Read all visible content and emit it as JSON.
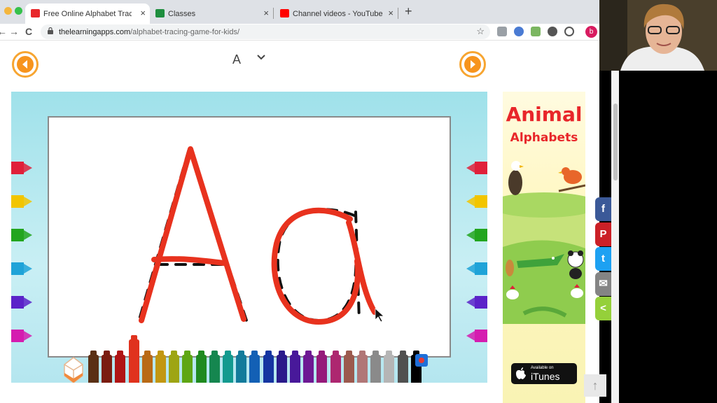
{
  "browser": {
    "tabs": [
      {
        "title": "Free Online Alphabet Tracing G",
        "close": "×",
        "favicon_color": "#e8262a",
        "active": true
      },
      {
        "title": "Classes",
        "close": "×",
        "favicon_color": "#1e8e3e",
        "active": false
      },
      {
        "title": "Channel videos - YouTube Stu",
        "close": "×",
        "favicon_color": "#ff0000",
        "active": false
      }
    ],
    "new_tab": "+",
    "url_domain": "thelearningapps.com",
    "url_path": "/alphabet-tracing-game-for-kids/",
    "back": "←",
    "forward": "→",
    "reload": "C",
    "star": "☆",
    "profile_initial": "b"
  },
  "page": {
    "selected_letter": "A",
    "prev_icon": "triangle-left-icon",
    "next_icon": "triangle-right-icon",
    "trace_color": "#e8321e",
    "side_crayon_colors": [
      "#e0203a",
      "#f2c500",
      "#22a51e",
      "#1fa3d8",
      "#5b23c9",
      "#d51cb0"
    ],
    "palette_colors": [
      "#5a3015",
      "#7a1c10",
      "#b01515",
      "#e0321e",
      "#b96a16",
      "#c29712",
      "#9ea514",
      "#5ea614",
      "#1f8a1f",
      "#15864f",
      "#139a8f",
      "#137b9b",
      "#1360b5",
      "#1535a1",
      "#2a1a8a",
      "#48199a",
      "#6d1993",
      "#951a7a",
      "#ad2770",
      "#9b5a4e",
      "#b07777",
      "#8a8a8a",
      "#b5b5b5",
      "#505050",
      "#000000"
    ],
    "selected_palette_index": 3
  },
  "ad": {
    "title": "Animal",
    "subtitle": "Alphabets",
    "badge_small": "Available on",
    "badge_big": "iTunes"
  },
  "share": [
    {
      "name": "facebook",
      "glyph": "f",
      "color": "#3b5998"
    },
    {
      "name": "pinterest",
      "glyph": "P",
      "color": "#cb2027"
    },
    {
      "name": "twitter",
      "glyph": "t",
      "color": "#1da1f2"
    },
    {
      "name": "email",
      "glyph": "✉",
      "color": "#848484"
    },
    {
      "name": "sharethis",
      "glyph": "<",
      "color": "#95d03a"
    }
  ],
  "scroll_top_glyph": "↑"
}
